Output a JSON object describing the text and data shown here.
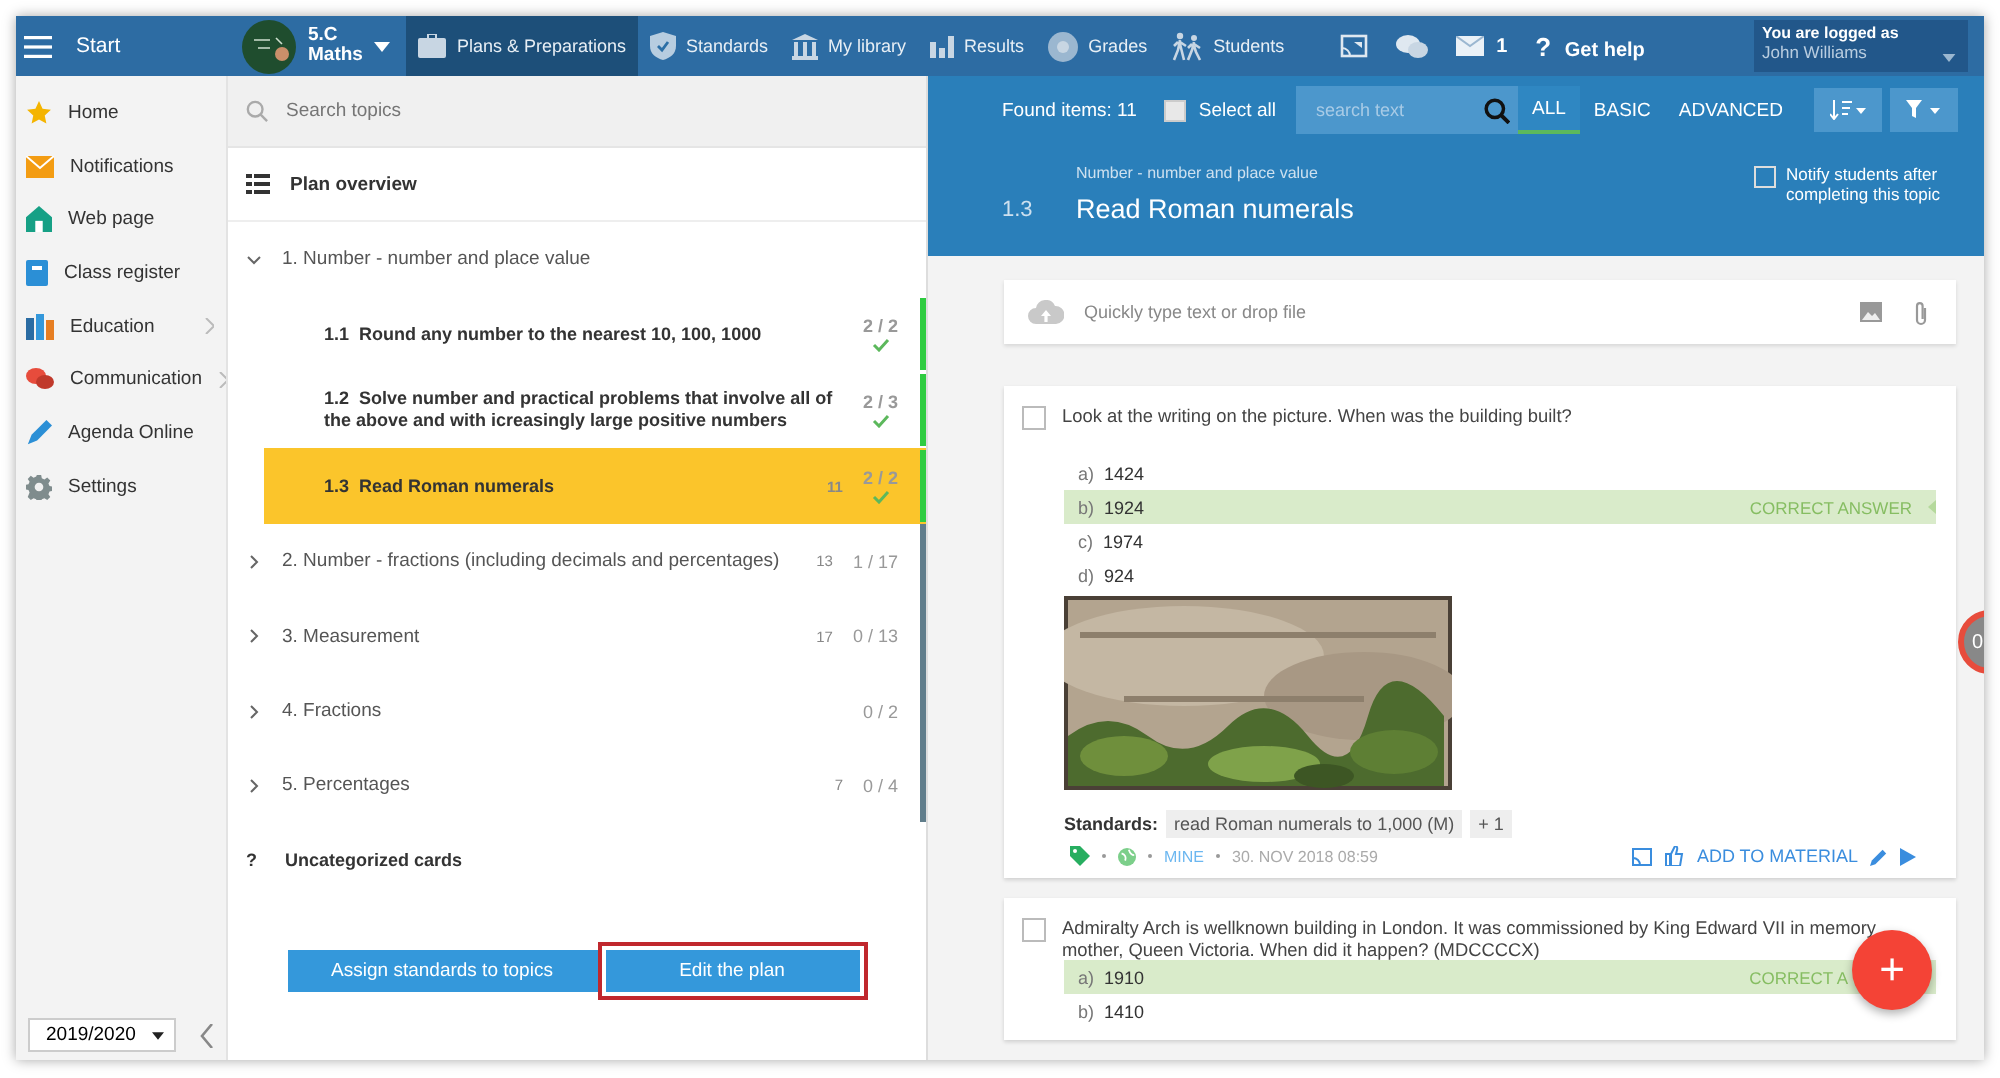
{
  "topbar": {
    "menu_label": "Start",
    "class_name": "5.C",
    "class_subject": "Maths",
    "nav": [
      {
        "label": "Plans & Preparations",
        "selected": true
      },
      {
        "label": "Standards",
        "selected": false
      },
      {
        "label": "My library",
        "selected": false
      },
      {
        "label": "Results",
        "selected": false
      },
      {
        "label": "Grades",
        "selected": false
      },
      {
        "label": "Students",
        "selected": false
      }
    ],
    "messages_count": "1",
    "help_mark": "?",
    "help_label": "Get help",
    "user_caption": "You are logged as",
    "user_name": "John Williams"
  },
  "sidebar": {
    "items": [
      {
        "label": "Home",
        "has_children": false
      },
      {
        "label": "Notifications",
        "has_children": false
      },
      {
        "label": "Web page",
        "has_children": false
      },
      {
        "label": "Class register",
        "has_children": false
      },
      {
        "label": "Education",
        "has_children": true
      },
      {
        "label": "Communication",
        "has_children": true
      },
      {
        "label": "Agenda Online",
        "has_children": false
      },
      {
        "label": "Settings",
        "has_children": false
      }
    ],
    "year": "2019/2020"
  },
  "plan": {
    "search_placeholder": "Search topics",
    "overview_label": "Plan overview",
    "topics": [
      {
        "label": "1. Number - number and place value",
        "expanded": true,
        "children": [
          {
            "number": "1.1",
            "title": "Round any number to the nearest 10, 100, 1000",
            "progress": "2 / 2",
            "done": true,
            "selected": false,
            "color": "#2ecc40"
          },
          {
            "number": "1.2",
            "title": "Solve number and practical problems that involve all of the above and with icreasingly large positive numbers",
            "progress": "2 / 3",
            "done": true,
            "selected": false,
            "color": "#2ecc40"
          },
          {
            "number": "1.3",
            "title": "Read Roman numerals",
            "count": "11",
            "progress": "2 / 2",
            "done": true,
            "selected": true,
            "color": "#2ecc40"
          }
        ]
      },
      {
        "label": "2. Number - fractions (including decimals and percentages)",
        "expanded": false,
        "count": "13",
        "progress": "1 / 17",
        "color": "#607d8b"
      },
      {
        "label": "3. Measurement",
        "expanded": false,
        "count": "17",
        "progress": "0 / 13",
        "color": "#607d8b"
      },
      {
        "label": "4. Fractions",
        "expanded": false,
        "progress": "0 / 2",
        "color": "#607d8b"
      },
      {
        "label": "5. Percentages",
        "expanded": false,
        "count": "7",
        "progress": "0 / 4",
        "color": "#607d8b"
      }
    ],
    "uncategorized_mark": "?",
    "uncategorized_label": "Uncategorized cards",
    "buttons": [
      {
        "label": "Assign standards to topics",
        "highlighted": false
      },
      {
        "label": "Edit the plan",
        "highlighted": true
      }
    ]
  },
  "content": {
    "found": "Found items: 11",
    "select_all": {
      "label": "Select all",
      "checked": false
    },
    "search_placeholder": "search text",
    "filters": [
      {
        "label": "ALL",
        "selected": true
      },
      {
        "label": "BASIC",
        "selected": false
      },
      {
        "label": "ADVANCED",
        "selected": false
      }
    ],
    "topic_parent": "Number - number and place value",
    "topic_number": "1.3",
    "topic_title": "Read Roman numerals",
    "notify": {
      "label": "Notify students after completing this topic",
      "checked": false
    },
    "upload_placeholder": "Quickly type text or drop file",
    "questions": [
      {
        "checked": false,
        "lines": [
          "Look at the writing on the picture. When was the building built?"
        ],
        "answers": [
          {
            "letter": "a)",
            "text": "1424",
            "correct": false
          },
          {
            "letter": "b)",
            "text": "1924",
            "correct": true
          },
          {
            "letter": "c)",
            "text": "1974",
            "correct": false
          },
          {
            "letter": "d)",
            "text": "924",
            "correct": false
          }
        ],
        "correct_label": "CORRECT ANSWER",
        "picture": {
          "kind": "picture"
        },
        "standards_label": "Standards:",
        "standards": [
          "read Roman numerals to 1,000 (M)",
          "+ 1"
        ],
        "owner": "MINE",
        "date": "30. NOV 2018 08:59",
        "add_label": "ADD TO MATERIAL"
      },
      {
        "checked": false,
        "lines": [
          "Admiralty Arch is wellknown building in London. It was commissioned by King Edward VII in memory",
          "mother, Queen Victoria. When did it happen? (MDCCCCX)"
        ],
        "answers": [
          {
            "letter": "a)",
            "text": "1910",
            "correct": true
          },
          {
            "letter": "b)",
            "text": "1410",
            "correct": false
          }
        ],
        "correct_label": "CORRECT A"
      }
    ],
    "side_badge": "0",
    "fab": "+"
  }
}
